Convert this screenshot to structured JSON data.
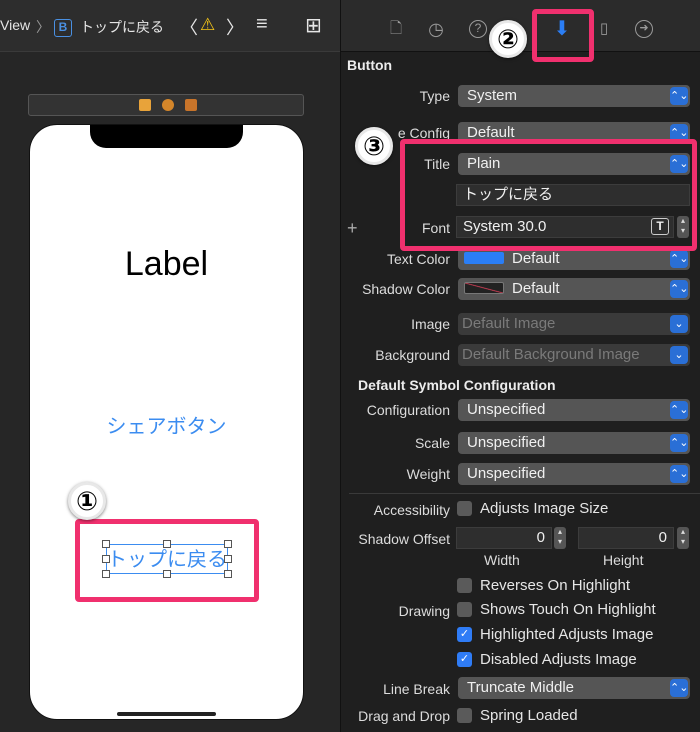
{
  "jumpbar": {
    "view_crumb": "View",
    "sep": "〉",
    "file_icon_letter": "B",
    "file_name": "トップに戻る",
    "nav_back": "〈",
    "nav_forward": "〉",
    "warning_icon": "⚠",
    "menu_icon": "≡",
    "add_icon": "⊞"
  },
  "canvas": {
    "label_text": "Label",
    "share_button": "シェアボタン",
    "top_button": "トップに戻る"
  },
  "annotations": {
    "step1": "①",
    "step2": "②",
    "step3": "③",
    "accent_color": "#f0306e"
  },
  "inspector": {
    "tabs": [
      "file-icon",
      "history-icon",
      "help-icon",
      "attributes-icon",
      "size-icon",
      "connections-icon"
    ],
    "tab_glyphs": {
      "file": "🗋",
      "history": "◷",
      "help": "?",
      "attributes": "⬇",
      "size": "▯",
      "connections": "➜"
    },
    "section_button": "Button",
    "type_label": "Type",
    "type_value": "System",
    "config_label": "e Config",
    "config_value": "Default",
    "title_label": "Title",
    "title_value": "Plain",
    "title_text": "トップに戻る",
    "font_label": "Font",
    "font_value": "System 30.0",
    "plus": "+",
    "text_color_label": "Text Color",
    "text_color_value": "Default",
    "text_color_swatch": "#2b7ef5",
    "shadow_color_label": "Shadow Color",
    "shadow_color_value": "Default",
    "image_label": "Image",
    "image_placeholder": "Default Image",
    "background_label": "Background",
    "background_placeholder": "Default Background Image",
    "section_symbol": "Default Symbol Configuration",
    "configuration_label": "Configuration",
    "configuration_value": "Unspecified",
    "scale_label": "Scale",
    "scale_value": "Unspecified",
    "weight_label": "Weight",
    "weight_value": "Unspecified",
    "accessibility_label": "Accessibility",
    "adjusts_image_size": "Adjusts Image Size",
    "shadow_offset_label": "Shadow Offset",
    "shadow_width_value": "0",
    "shadow_height_value": "0",
    "width_label": "Width",
    "height_label": "Height",
    "reverses_on_highlight": "Reverses On Highlight",
    "drawing_label": "Drawing",
    "shows_touch": "Shows Touch On Highlight",
    "highlighted_adjusts": "Highlighted Adjusts Image",
    "disabled_adjusts": "Disabled Adjusts Image",
    "line_break_label": "Line Break",
    "line_break_value": "Truncate Middle",
    "drag_drop_label": "Drag and Drop",
    "spring_loaded": "Spring Loaded",
    "popup_arrow": "⌃⌄",
    "dropdown_arrow": "⌄",
    "check_glyph": "✓"
  }
}
